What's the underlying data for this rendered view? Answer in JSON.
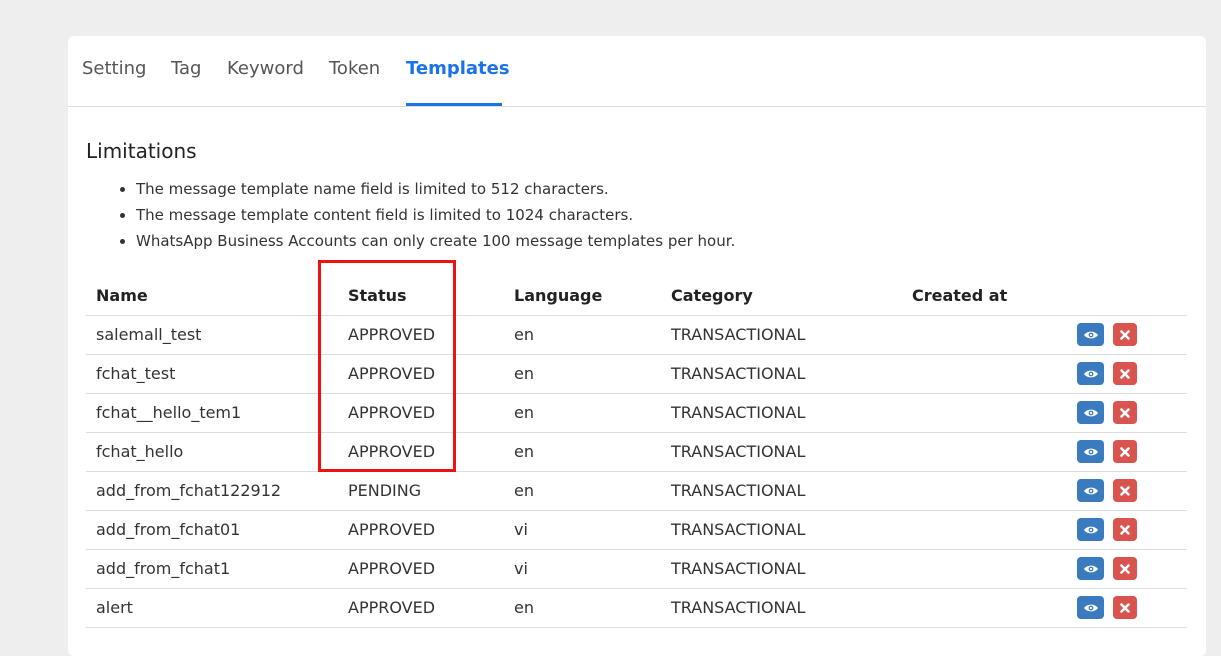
{
  "tabs": [
    {
      "label": "Setting"
    },
    {
      "label": "Tag"
    },
    {
      "label": "Keyword"
    },
    {
      "label": "Token"
    },
    {
      "label": "Templates",
      "active": true
    }
  ],
  "limitations": {
    "title": "Limitations",
    "items": [
      "The message template name field is limited to 512 characters.",
      "The message template content field is limited to 1024 characters.",
      "WhatsApp Business Accounts can only create 100 message templates per hour."
    ]
  },
  "table": {
    "headers": {
      "name": "Name",
      "status": "Status",
      "language": "Language",
      "category": "Category",
      "created_at": "Created at"
    },
    "rows": [
      {
        "name": "salemall_test",
        "status": "APPROVED",
        "language": "en",
        "category": "TRANSACTIONAL",
        "created_at": ""
      },
      {
        "name": "fchat_test",
        "status": "APPROVED",
        "language": "en",
        "category": "TRANSACTIONAL",
        "created_at": ""
      },
      {
        "name": "fchat__hello_tem1",
        "status": "APPROVED",
        "language": "en",
        "category": "TRANSACTIONAL",
        "created_at": ""
      },
      {
        "name": "fchat_hello",
        "status": "APPROVED",
        "language": "en",
        "category": "TRANSACTIONAL",
        "created_at": ""
      },
      {
        "name": "add_from_fchat122912",
        "status": "PENDING",
        "language": "en",
        "category": "TRANSACTIONAL",
        "created_at": ""
      },
      {
        "name": "add_from_fchat01",
        "status": "APPROVED",
        "language": "vi",
        "category": "TRANSACTIONAL",
        "created_at": ""
      },
      {
        "name": "add_from_fchat1",
        "status": "APPROVED",
        "language": "vi",
        "category": "TRANSACTIONAL",
        "created_at": ""
      },
      {
        "name": "alert",
        "status": "APPROVED",
        "language": "en",
        "category": "TRANSACTIONAL",
        "created_at": ""
      }
    ]
  },
  "colors": {
    "accent": "#1a73e8",
    "view_button": "#3a7bbf",
    "delete_button": "#d9534f",
    "highlight": "#ee1111"
  },
  "icons": {
    "view": "eye-icon",
    "delete": "close-icon"
  }
}
